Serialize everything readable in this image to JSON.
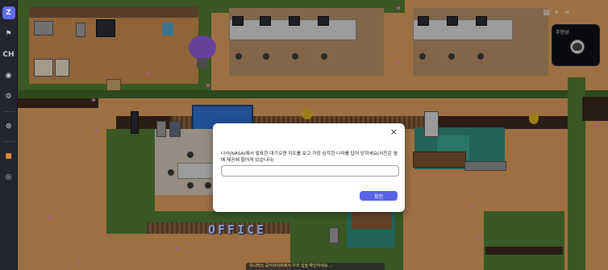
{
  "toolbar": {
    "logo_label": "Z",
    "items": [
      {
        "name": "megaphone-icon",
        "glyph": "⚑"
      },
      {
        "name": "channel-button",
        "glyph": "CH"
      },
      {
        "name": "location-icon",
        "glyph": "◉"
      },
      {
        "name": "settings-icon",
        "glyph": "⚙"
      },
      {
        "name": "mask-icon",
        "glyph": "⊙"
      },
      {
        "name": "avatar-icon",
        "glyph": "■"
      },
      {
        "name": "status-icon",
        "glyph": "◎"
      }
    ]
  },
  "top_controls": {
    "grid_icon": "▦",
    "dropdown_icon": "▾",
    "exit_icon": "⇥"
  },
  "video_card": {
    "user_name": "주현성"
  },
  "map": {
    "sign_text": "OFFICE"
  },
  "modal": {
    "close_label": "×",
    "question": "나사(NASA)에서 발표한 대기오염 지도를 보고 가장 심각한 나라를 답어 닫하세요(사진은 옆에 제공에 떨어져 있습니다)",
    "input_value": "",
    "input_placeholder": "",
    "confirm_label": "확인"
  },
  "bottom_strip": {
    "text": "유니버스 공식사이트에서 우리 집을 확인하세요 ..."
  }
}
